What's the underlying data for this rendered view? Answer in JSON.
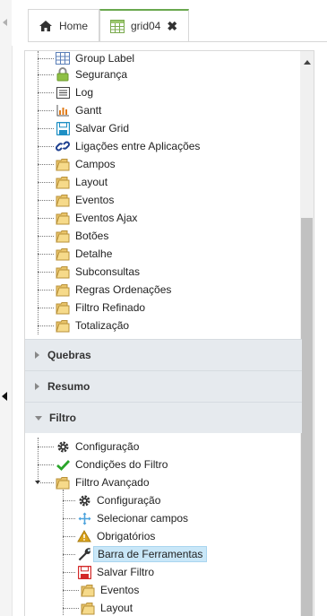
{
  "tabs": [
    {
      "label": "Home",
      "icon": "home-icon"
    },
    {
      "label": "grid04",
      "icon": "grid-icon",
      "close": "✖",
      "active": true
    }
  ],
  "tree_top": {
    "items": [
      {
        "label": "Group Label",
        "icon": "group-label-icon"
      },
      {
        "label": "Segurança",
        "icon": "lock-icon"
      },
      {
        "label": "Log",
        "icon": "log-icon"
      },
      {
        "label": "Gantt",
        "icon": "gantt-icon"
      },
      {
        "label": "Salvar Grid",
        "icon": "save-icon"
      },
      {
        "label": "Ligações entre Aplicações",
        "icon": "link-icon"
      },
      {
        "label": "Campos",
        "icon": "folder-icon"
      },
      {
        "label": "Layout",
        "icon": "folder-icon"
      },
      {
        "label": "Eventos",
        "icon": "folder-icon"
      },
      {
        "label": "Eventos Ajax",
        "icon": "folder-icon"
      },
      {
        "label": "Botões",
        "icon": "folder-icon"
      },
      {
        "label": "Detalhe",
        "icon": "folder-icon"
      },
      {
        "label": "Subconsultas",
        "icon": "folder-icon"
      },
      {
        "label": "Regras Ordenações",
        "icon": "folder-icon"
      },
      {
        "label": "Filtro Refinado",
        "icon": "folder-icon"
      },
      {
        "label": "Totalização",
        "icon": "folder-icon"
      }
    ]
  },
  "sections": [
    {
      "label": "Quebras",
      "expanded": false
    },
    {
      "label": "Resumo",
      "expanded": false
    },
    {
      "label": "Filtro",
      "expanded": true
    }
  ],
  "filtro_tree": {
    "items": [
      {
        "label": "Configuração",
        "icon": "gear-icon"
      },
      {
        "label": "Condições do Filtro",
        "icon": "check-icon"
      },
      {
        "label": "Filtro Avançado",
        "icon": "folder-icon"
      }
    ],
    "children": [
      {
        "label": "Configuração",
        "icon": "gear-icon"
      },
      {
        "label": "Selecionar campos",
        "icon": "move-icon"
      },
      {
        "label": "Obrigatórios",
        "icon": "warning-icon"
      },
      {
        "label": "Barra de Ferramentas",
        "icon": "wrench-icon",
        "selected": true
      },
      {
        "label": "Salvar Filtro",
        "icon": "save-red-icon"
      },
      {
        "label": "Eventos",
        "icon": "folder-icon"
      },
      {
        "label": "Layout",
        "icon": "folder-icon"
      }
    ]
  }
}
